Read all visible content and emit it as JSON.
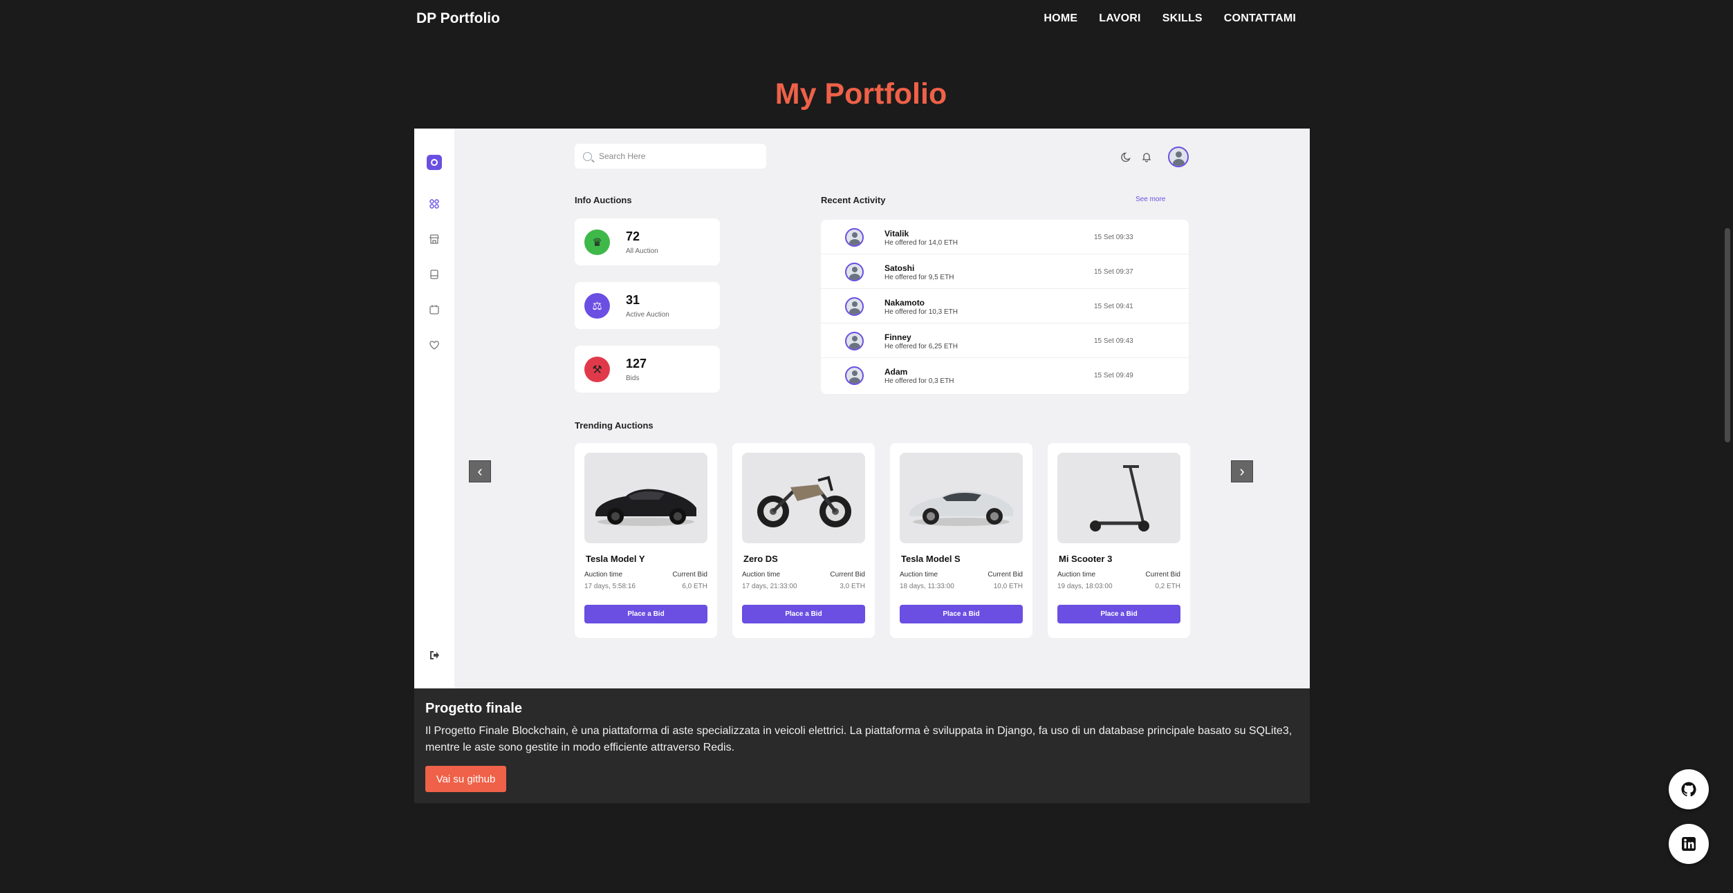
{
  "nav": {
    "brand": "DP Portfolio",
    "links": [
      "HOME",
      "LAVORI",
      "SKILLS",
      "CONTATTAMI"
    ]
  },
  "page_title": "My Portfolio",
  "dashboard": {
    "search_placeholder": "Search Here",
    "info_title": "Info Auctions",
    "recent_title": "Recent Activity",
    "see_more": "See more",
    "trending_title": "Trending Auctions",
    "stats": [
      {
        "value": "72",
        "label": "All Auction",
        "color": "#3fb84a"
      },
      {
        "value": "31",
        "label": "Active Auction",
        "color": "#6a4fe2"
      },
      {
        "value": "127",
        "label": "Bids",
        "color": "#e03a4a"
      }
    ],
    "activity": [
      {
        "name": "Vitalik",
        "desc": "He offered for 14,0 ETH",
        "time": "15 Set 09:33"
      },
      {
        "name": "Satoshi",
        "desc": "He offered for 9,5 ETH",
        "time": "15 Set 09:37"
      },
      {
        "name": "Nakamoto",
        "desc": "He offered for 10,3 ETH",
        "time": "15 Set 09:41"
      },
      {
        "name": "Finney",
        "desc": "He offered for 6,25 ETH",
        "time": "15 Set 09:43"
      },
      {
        "name": "Adam",
        "desc": "He offered for 0,3 ETH",
        "time": "15 Set 09:49"
      }
    ],
    "auctions": [
      {
        "name": "Tesla Model Y",
        "time_label": "Auction time",
        "bid_label": "Current Bid",
        "time": "17 days, 5:58:16",
        "bid": "6,0 ETH",
        "button": "Place a Bid"
      },
      {
        "name": "Zero DS",
        "time_label": "Auction time",
        "bid_label": "Current Bid",
        "time": "17 days, 21:33:00",
        "bid": "3,0 ETH",
        "button": "Place a Bid"
      },
      {
        "name": "Tesla Model S",
        "time_label": "Auction time",
        "bid_label": "Current Bid",
        "time": "18 days, 11:33:00",
        "bid": "10,0 ETH",
        "button": "Place a Bid"
      },
      {
        "name": "Mi Scooter 3",
        "time_label": "Auction time",
        "bid_label": "Current Bid",
        "time": "19 days, 18:03:00",
        "bid": "0,2 ETH",
        "button": "Place a Bid"
      }
    ],
    "accent": "#6a4fe2"
  },
  "project": {
    "title": "Progetto finale",
    "description": "Il Progetto Finale Blockchain, è una piattaforma di aste specializzata in veicoli elettrici. La piattaforma è sviluppata in Django, fa uso di un database principale basato su SQLite3, mentre le aste sono gestite in modo efficiente attraverso Redis.",
    "button": "Vai su github"
  },
  "colors": {
    "accent": "#ef6148",
    "background": "#1b1b1b"
  },
  "fabs": [
    "github-icon",
    "linkedin-icon"
  ]
}
